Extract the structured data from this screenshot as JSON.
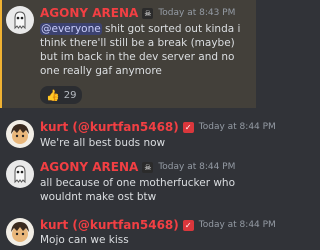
{
  "messages": [
    {
      "author": "AGONY ARENA",
      "author_color": "#f23f43",
      "badge_icon": "ghost-icon",
      "timestamp": "Today at 8:43 PM",
      "mention": "@everyone",
      "text": " shit got sorted out kinda i think there'll still be a break (maybe) but im back in the dev server and no one really gaf anymore",
      "reaction": {
        "emoji_icon": "thumbs-up-icon",
        "count": "29"
      }
    },
    {
      "author": "kurt (@kurtfan5468)",
      "author_color": "#f23f43",
      "badge_icon": "check-badge-icon",
      "timestamp": "Today at 8:44 PM",
      "text": "We're all best buds now"
    },
    {
      "author": "AGONY ARENA",
      "author_color": "#f23f43",
      "badge_icon": "ghost-icon",
      "timestamp": "Today at 8:44 PM",
      "text": "all because of one motherfucker who wouldnt make ost btw"
    },
    {
      "author": "kurt (@kurtfan5468)",
      "author_color": "#f23f43",
      "badge_icon": "check-badge-icon",
      "timestamp": "Today at 8:44 PM",
      "text": "Mojo can we kiss"
    }
  ]
}
